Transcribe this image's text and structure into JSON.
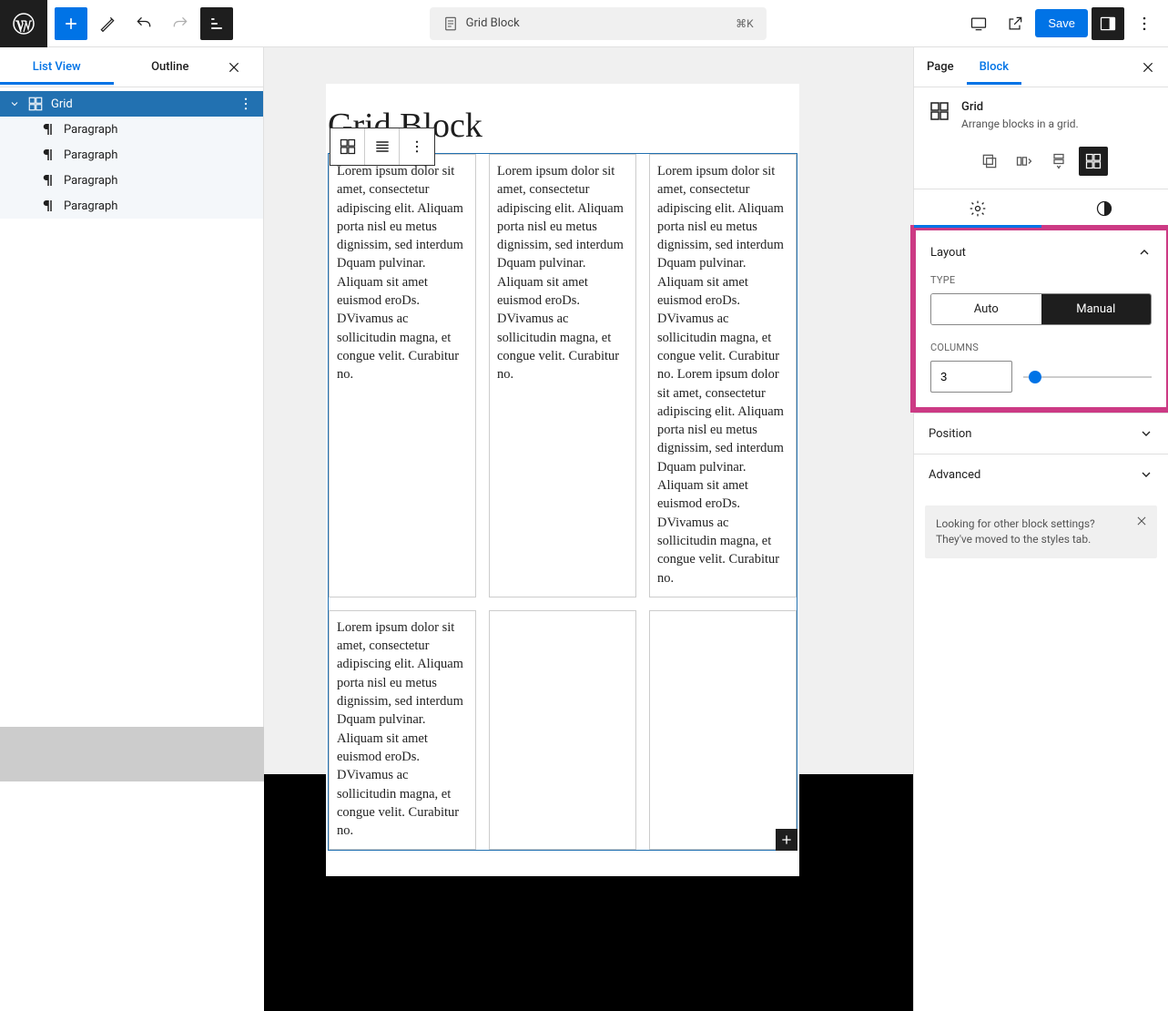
{
  "topbar": {
    "doc_title": "Grid Block",
    "shortcut": "⌘K",
    "save_label": "Save"
  },
  "left_panel": {
    "tabs": {
      "list_view": "List View",
      "outline": "Outline"
    },
    "tree": {
      "root": "Grid",
      "children": [
        "Paragraph",
        "Paragraph",
        "Paragraph",
        "Paragraph"
      ]
    }
  },
  "canvas": {
    "heading": "Grid Block",
    "lorem_short": "Lorem ipsum dolor sit amet, consectetur adipiscing elit. Aliquam porta nisl eu metus dignissim, sed interdum Dquam pulvinar. Aliquam sit amet euismod eroDs. DVivamus ac sollicitudin magna, et congue velit. Curabitur no.",
    "lorem_long": "Lorem ipsum dolor sit amet, consectetur adipiscing elit. Aliquam porta nisl eu metus dignissim, sed interdum Dquam pulvinar. Aliquam sit amet euismod eroDs. DVivamus ac sollicitudin magna, et congue velit. Curabitur no. Lorem ipsum dolor sit amet, consectetur adipiscing elit. Aliquam porta nisl eu metus dignissim, sed interdum Dquam pulvinar. Aliquam sit amet euismod eroDs. DVivamus ac sollicitudin magna, et congue velit. Curabitur no."
  },
  "right_panel": {
    "tabs": {
      "page": "Page",
      "block": "Block"
    },
    "block_name": "Grid",
    "block_desc": "Arrange blocks in a grid.",
    "layout_section": "Layout",
    "type_label": "TYPE",
    "type_auto": "Auto",
    "type_manual": "Manual",
    "columns_label": "COLUMNS",
    "columns_value": "3",
    "position_section": "Position",
    "advanced_section": "Advanced",
    "notice": "Looking for other block settings? They've moved to the styles tab."
  }
}
